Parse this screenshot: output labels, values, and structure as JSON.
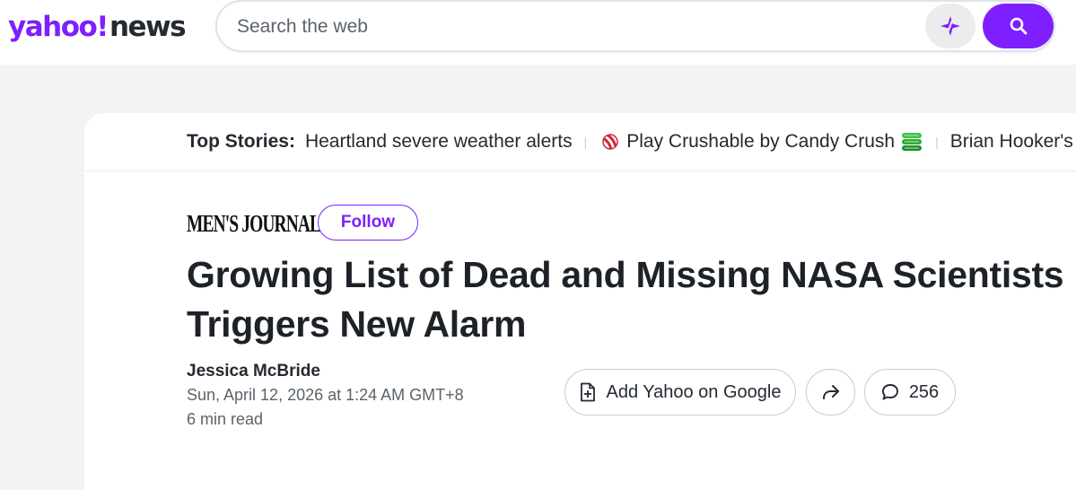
{
  "header": {
    "logo": {
      "brand": "yahoo!",
      "section": "news"
    },
    "search": {
      "placeholder": "Search the web"
    },
    "icons": {
      "ai": "sparkle-icon",
      "search": "search-icon"
    },
    "colors": {
      "brand_purple": "#7e1fff",
      "text_dark": "#232a31"
    }
  },
  "top_stories": {
    "label": "Top Stories:",
    "items": [
      {
        "text": "Heartland severe weather alerts"
      },
      {
        "text": "Play Crushable by Candy Crush",
        "leading_icon": "candy-icon",
        "trailing_icon": "game-stack-icon"
      },
      {
        "text": "Brian Hooker's"
      }
    ]
  },
  "article": {
    "publisher": "MEN'S JOURNAL",
    "follow_label": "Follow",
    "headline": "Growing List of Dead and Missing NASA Scientists Triggers New Alarm",
    "author": "Jessica McBride",
    "date": "Sun, April 12, 2026 at 1:24 AM GMT+8",
    "read_time": "6 min read",
    "actions": {
      "add_google_label": "Add Yahoo on Google",
      "comments_count": "256",
      "icons": {
        "add": "add-document-icon",
        "share": "share-icon",
        "comments": "comment-icon"
      }
    }
  }
}
